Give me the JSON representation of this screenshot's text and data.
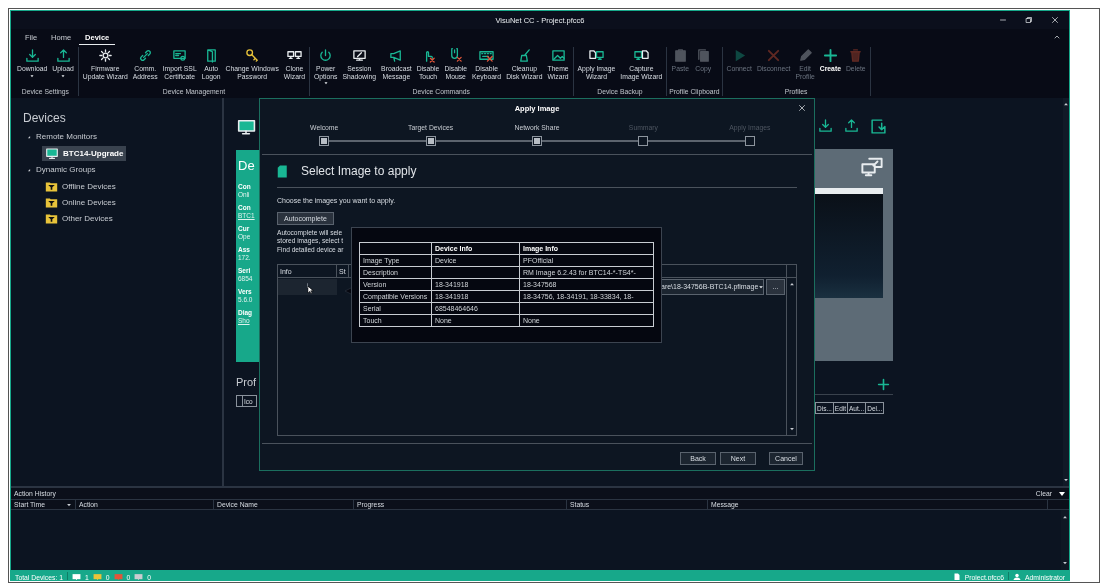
{
  "window": {
    "title": "VisuNet CC - Project.pfcc6"
  },
  "menu_tabs": [
    {
      "label": "File",
      "selected": false
    },
    {
      "label": "Home",
      "selected": false
    },
    {
      "label": "Device",
      "selected": true
    }
  ],
  "ribbon_groups": [
    {
      "label": "Device Settings",
      "buttons": [
        {
          "label": "Download",
          "dropdown": true,
          "disabled": false
        },
        {
          "label": "Upload",
          "dropdown": true,
          "disabled": false
        }
      ]
    },
    {
      "label": "Device Management",
      "buttons": [
        {
          "label": "Firmware\nUpdate Wizard",
          "dropdown": false,
          "disabled": false
        },
        {
          "label": "Comm.\nAddress",
          "dropdown": false,
          "disabled": false
        },
        {
          "label": "Import SSL\nCertificate",
          "dropdown": false,
          "disabled": false
        },
        {
          "label": "Auto\nLogon",
          "dropdown": false,
          "disabled": false
        },
        {
          "label": "Change Windows\nPassword",
          "dropdown": false,
          "disabled": false
        },
        {
          "label": "Clone\nWizard",
          "dropdown": false,
          "disabled": false
        }
      ]
    },
    {
      "label": "Device Commands",
      "buttons": [
        {
          "label": "Power\nOptions",
          "dropdown": true,
          "disabled": false
        },
        {
          "label": "Session\nShadowing",
          "dropdown": false,
          "disabled": false
        },
        {
          "label": "Broadcast\nMessage",
          "dropdown": false,
          "disabled": false
        },
        {
          "label": "Disable\nTouch",
          "dropdown": false,
          "disabled": false
        },
        {
          "label": "Disable\nMouse",
          "dropdown": false,
          "disabled": false
        },
        {
          "label": "Disable\nKeyboard",
          "dropdown": false,
          "disabled": false
        },
        {
          "label": "Cleanup\nDisk Wizard",
          "dropdown": false,
          "disabled": false
        },
        {
          "label": "Theme\nWizard",
          "dropdown": false,
          "disabled": false
        }
      ]
    },
    {
      "label": "Device Backup",
      "buttons": [
        {
          "label": "Apply Image\nWizard",
          "dropdown": false,
          "disabled": false
        },
        {
          "label": "Capture\nImage Wizard",
          "dropdown": false,
          "disabled": false
        }
      ]
    },
    {
      "label": "Profile Clipboard",
      "buttons": [
        {
          "label": "Paste",
          "dropdown": false,
          "disabled": true
        },
        {
          "label": "Copy",
          "dropdown": false,
          "disabled": true
        }
      ]
    },
    {
      "label": "Profiles",
      "buttons": [
        {
          "label": "Connect",
          "dropdown": false,
          "disabled": true
        },
        {
          "label": "Disconnect",
          "dropdown": false,
          "disabled": true
        },
        {
          "label": "Edit\nProfile",
          "dropdown": false,
          "disabled": true
        },
        {
          "label": "Create",
          "dropdown": false,
          "disabled": false
        },
        {
          "label": "Delete",
          "dropdown": false,
          "disabled": true
        }
      ]
    }
  ],
  "device_tree": {
    "title": "Devices",
    "items": [
      {
        "label": "Remote Monitors",
        "kind": "category",
        "expanded": true,
        "selected": false,
        "children": [
          {
            "label": "BTC14-Upgrade",
            "kind": "device",
            "selected": true
          }
        ]
      },
      {
        "label": "Dynamic Groups",
        "kind": "category",
        "expanded": true,
        "selected": false,
        "children": [
          {
            "label": "Offline Devices",
            "kind": "filter",
            "selected": false
          },
          {
            "label": "Online Devices",
            "kind": "filter",
            "selected": false
          },
          {
            "label": "Other Devices",
            "kind": "filter",
            "selected": false
          }
        ]
      }
    ]
  },
  "device_details": {
    "title": "De",
    "fields": [
      {
        "label": "Con",
        "value": "Onli",
        "link": false
      },
      {
        "label": "Con",
        "value": "BTC1",
        "link": true
      },
      {
        "label": "Cur",
        "value": "Ope",
        "link": false
      },
      {
        "label": "Ass",
        "value": "172.",
        "link": false
      },
      {
        "label": "Seri",
        "value": "6854",
        "link": false
      },
      {
        "label": "Vers",
        "value": "5.6.0",
        "link": false
      },
      {
        "label": "Diag",
        "value": "Sho",
        "link": true
      }
    ]
  },
  "profiles": {
    "title": "Prof",
    "columns": [
      "Ico",
      "Dis...",
      "Edit",
      "Aut...",
      "Del..."
    ]
  },
  "dialog": {
    "title": "Apply Image",
    "steps": [
      {
        "label": "Welcome",
        "completed": true
      },
      {
        "label": "Target Devices",
        "completed": true
      },
      {
        "label": "Network Share",
        "completed": true
      },
      {
        "label": "Summary",
        "completed": false
      },
      {
        "label": "Apply Images",
        "completed": false
      }
    ],
    "heading": "Select Image to apply",
    "instruction": "Choose the images you want to apply.",
    "autocomplete_button": "Autocomplete",
    "note": "Autocomplete will sele\nstored images, select t\nFind detailed device ar",
    "grid": {
      "columns": [
        "Info",
        "St"
      ],
      "rows": [
        {
          "info": "i",
          "image_path": "are\\18-34756B-BTC14.pfimage",
          "browse": "..."
        }
      ]
    },
    "image_info_popup": {
      "columns": [
        "Device Info",
        "Image Info"
      ],
      "rows": [
        {
          "label": "Image Type",
          "device": "Device",
          "image": "PFOfficial"
        },
        {
          "label": "Description",
          "image": "RM Image 6.2.43 for BTC14-*-TS4*-"
        },
        {
          "label": "Version",
          "device": "18-341918",
          "image": "18-347568"
        },
        {
          "label": "Compatible Versions",
          "device": "18-341918",
          "image": "18-34756, 18-34191, 18-33834, 18-"
        },
        {
          "label": "Serial",
          "device": "68548464646"
        },
        {
          "label": "Touch",
          "device": "None",
          "image": "None"
        }
      ]
    },
    "buttons": [
      "Back",
      "Next",
      "Cancel"
    ]
  },
  "action_history": {
    "title": "Action History",
    "clear": "Clear",
    "columns": [
      "Start Time",
      "Action",
      "Device Name",
      "Progress",
      "Status",
      "Message"
    ]
  },
  "status_bar": {
    "total": "Total Devices: 1",
    "device_counts": [
      {
        "count": "1",
        "color": "#ffffff"
      },
      {
        "count": "0",
        "color": "#e8c33a"
      },
      {
        "count": "0",
        "color": "#e0553a"
      },
      {
        "count": "0",
        "color": "#c8ccd0"
      }
    ],
    "project": "Project.pfcc6",
    "user": "Administrator"
  }
}
